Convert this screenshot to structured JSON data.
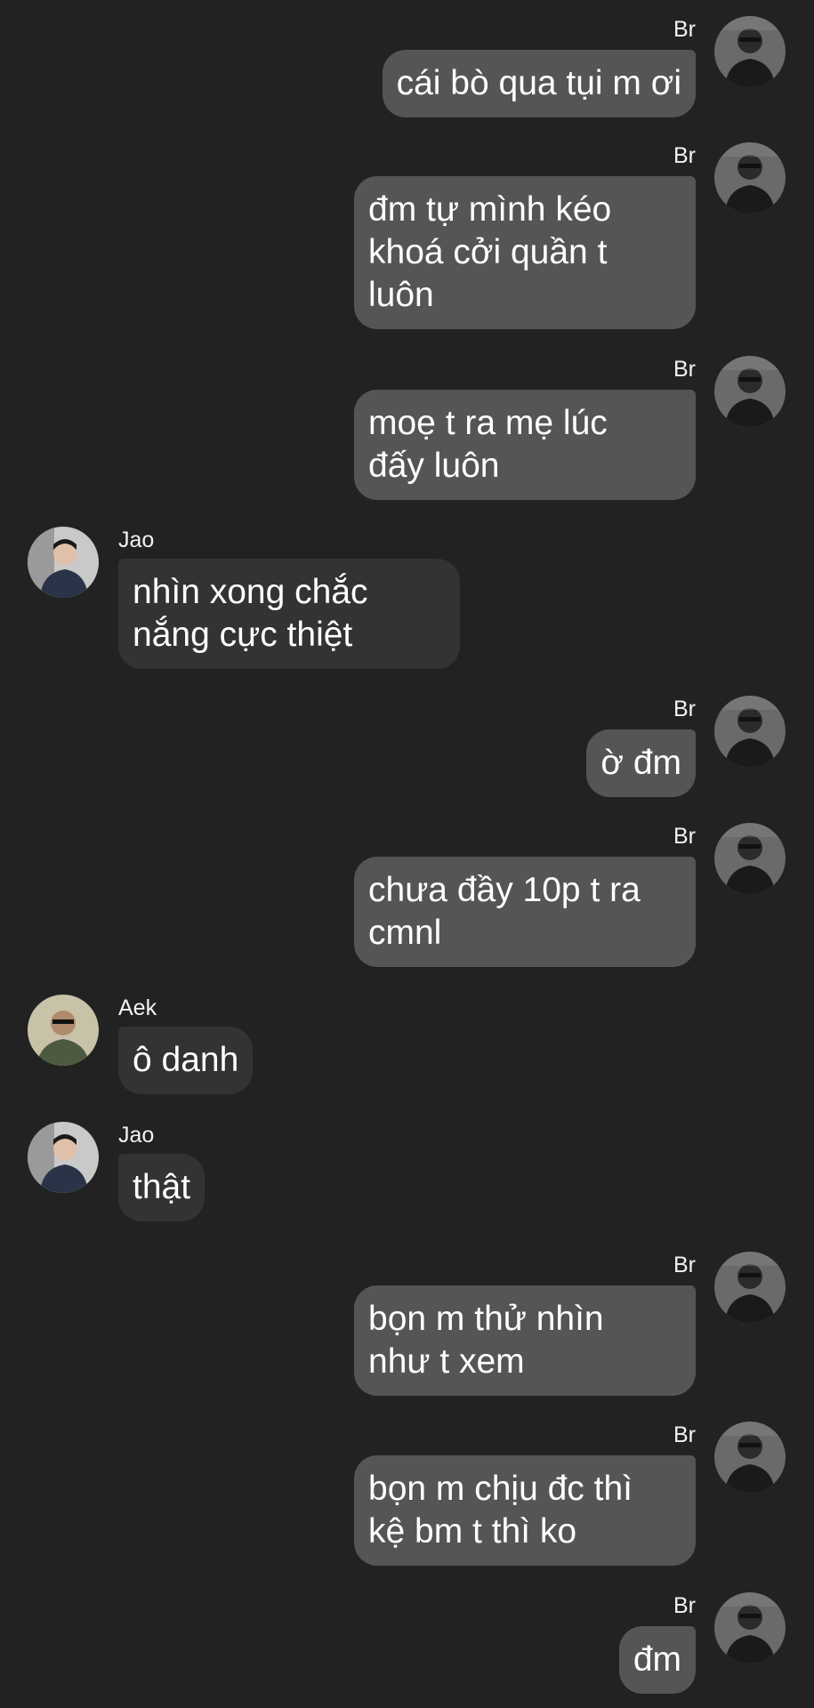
{
  "chat": {
    "messages": [
      {
        "sender": "Br",
        "side": "right",
        "lines": [
          "cái bò qua tụi m ơi"
        ]
      },
      {
        "sender": "Br",
        "side": "right",
        "lines": [
          "đm tự mình kéo",
          "khoá cởi quần t",
          "luôn"
        ]
      },
      {
        "sender": "Br",
        "side": "right",
        "lines": [
          "moẹ t ra mẹ lúc",
          "đấy luôn"
        ]
      },
      {
        "sender": "Jao",
        "side": "left",
        "lines": [
          "nhìn xong chắc",
          "nắng cực thiệt"
        ]
      },
      {
        "sender": "Br",
        "side": "right",
        "lines": [
          "ờ đm"
        ]
      },
      {
        "sender": "Br",
        "side": "right",
        "lines": [
          "chưa đầy 10p t ra",
          "cmnl"
        ]
      },
      {
        "sender": "Aek",
        "side": "left",
        "lines": [
          "ô danh"
        ]
      },
      {
        "sender": "Jao",
        "side": "left",
        "lines": [
          "thật"
        ]
      },
      {
        "sender": "Br",
        "side": "right",
        "lines": [
          "bọn m thử nhìn",
          "như t xem"
        ]
      },
      {
        "sender": "Br",
        "side": "right",
        "lines": [
          "bọn m chịu đc thì",
          "kệ bm t thì ko"
        ]
      },
      {
        "sender": "Br",
        "side": "right",
        "lines": [
          "đm"
        ]
      }
    ]
  },
  "colors": {
    "background": "#222222",
    "outgoing_bubble": "#555555",
    "incoming_bubble": "#333333",
    "text": "#ffffff"
  },
  "icons": {
    "avatar_br": "avatar-icon-br",
    "avatar_jao": "avatar-icon-jao",
    "avatar_aek": "avatar-icon-aek"
  }
}
